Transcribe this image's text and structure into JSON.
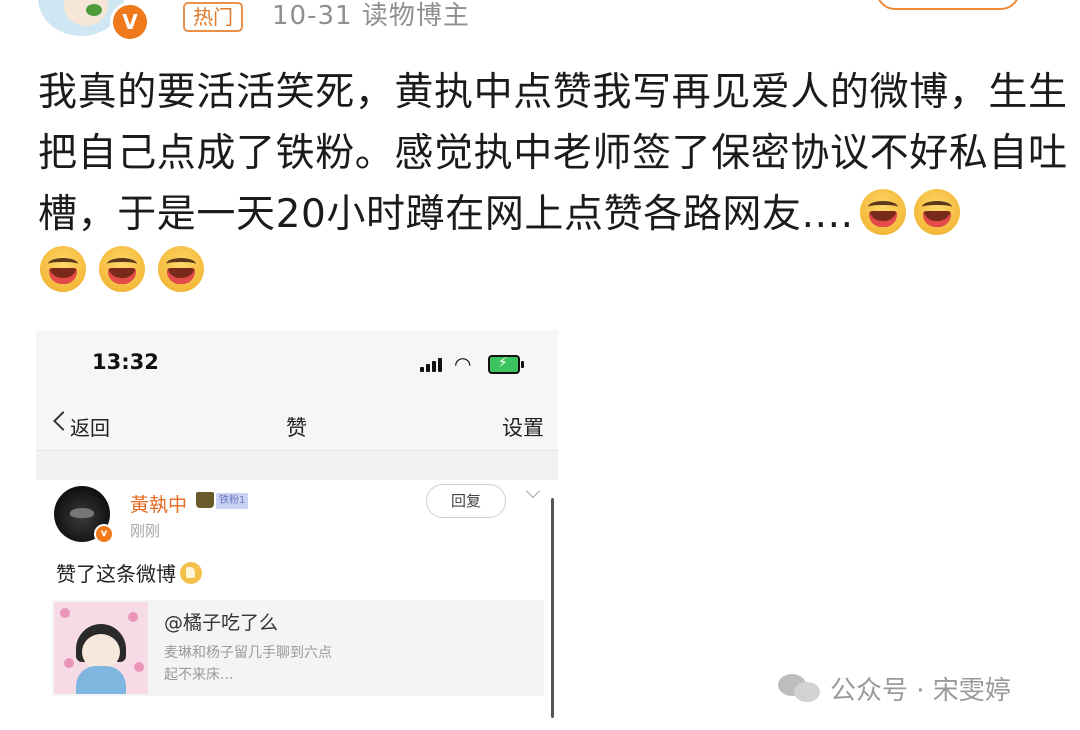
{
  "post": {
    "hot_tag": "热门",
    "meta": "10-31  读物博主",
    "verified_badge": "V",
    "text": "我真的要活活笑死，黄执中点赞我写再见爱人的微博，生生把自己点成了铁粉。感觉执中老师签了保密协议不好私自吐槽，于是一天20小时蹲在网上点赞各路网友....",
    "emoji_count": 5
  },
  "screenshot": {
    "status_time": "13:32",
    "nav": {
      "back_label": "返回",
      "title": "赞",
      "settings_label": "设置"
    },
    "notification": {
      "user_name": "黃執中",
      "fan_badge": "铁粉1",
      "time": "刚刚",
      "reply_label": "回复",
      "action": "赞了这条微博",
      "quote": {
        "title": "@橘子吃了么",
        "line1": "麦琳和杨子留几手聊到六点",
        "line2": "起不来床..."
      }
    }
  },
  "watermark": {
    "text": "公众号 · 宋雯婷"
  },
  "colors": {
    "accent": "#f07a1b",
    "hot_tag": "#e07a2a",
    "name": "#e46a1f",
    "fan_badge_bg": "#c9d2f2"
  }
}
